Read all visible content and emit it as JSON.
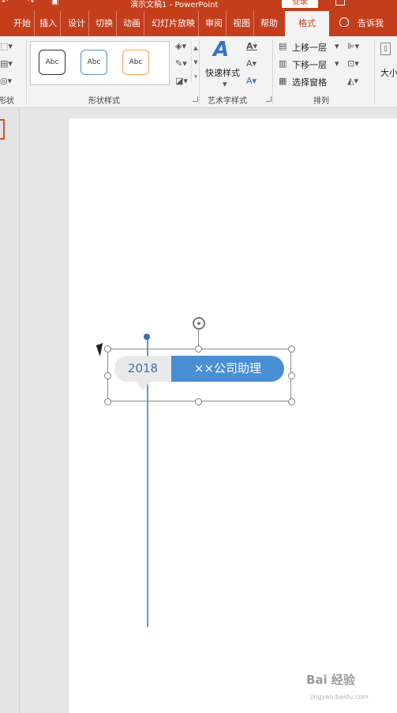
{
  "titlebar": {
    "title": "演示文稿1 - PowerPoint",
    "login_label": "登录"
  },
  "tabs": [
    {
      "label": "开始"
    },
    {
      "label": "插入"
    },
    {
      "label": "设计"
    },
    {
      "label": "切换"
    },
    {
      "label": "动画"
    },
    {
      "label": "幻灯片放映"
    },
    {
      "label": "审阅"
    },
    {
      "label": "视图"
    },
    {
      "label": "帮助"
    },
    {
      "label": "格式"
    }
  ],
  "tell_me": "告诉我",
  "ribbon": {
    "groups": {
      "shapes_partial": "形状",
      "shape_styles": "形状样式",
      "wordart_styles": "艺术字样式",
      "arrange": "排列",
      "size": "大小"
    },
    "gallery_items": [
      "Abc",
      "Abc",
      "Abc"
    ],
    "quick_styles_label": "快速样式",
    "arrange_commands": [
      "上移一层",
      "下移一层",
      "选择窗格"
    ]
  },
  "slide": {
    "year": "2018",
    "caption": "××公司助理"
  },
  "watermark": {
    "text": "Bai 经验",
    "sub": "jingyan.baidu.com"
  },
  "colors": {
    "accent": "#c43e1c",
    "pill_blue": "#4a8fd4",
    "pill_grey": "#e9e9e9",
    "year_text": "#3c6fb4",
    "line_blue": "#5b9bd5"
  }
}
